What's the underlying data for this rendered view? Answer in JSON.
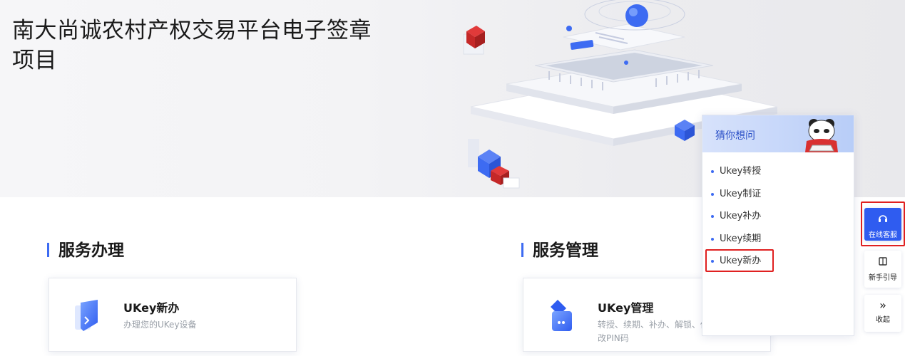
{
  "banner": {
    "title": "南大尚诚农村产权交易平台电子签章项目"
  },
  "sections": [
    {
      "title": "服务办理",
      "card": {
        "title": "UKey新办",
        "desc": "办理您的UKey设备"
      }
    },
    {
      "title": "服务管理",
      "card": {
        "title": "UKey管理",
        "desc": "转授、续期、补办、解锁、修改PIN码"
      }
    }
  ],
  "guess": {
    "title": "猜你想问",
    "items": [
      "Ukey转授",
      "Ukey制证",
      "Ukey补办",
      "Ukey续期",
      "Ukey新办"
    ]
  },
  "floatbar": {
    "online_service": "在线客服",
    "guide": "新手引导",
    "collapse": "收起"
  },
  "icons": {
    "headset": "headset-icon",
    "book": "book-icon",
    "collapse": "double-chevron-right-icon"
  },
  "colors": {
    "accent": "#2f5cf0",
    "highlight": "#e02020"
  }
}
